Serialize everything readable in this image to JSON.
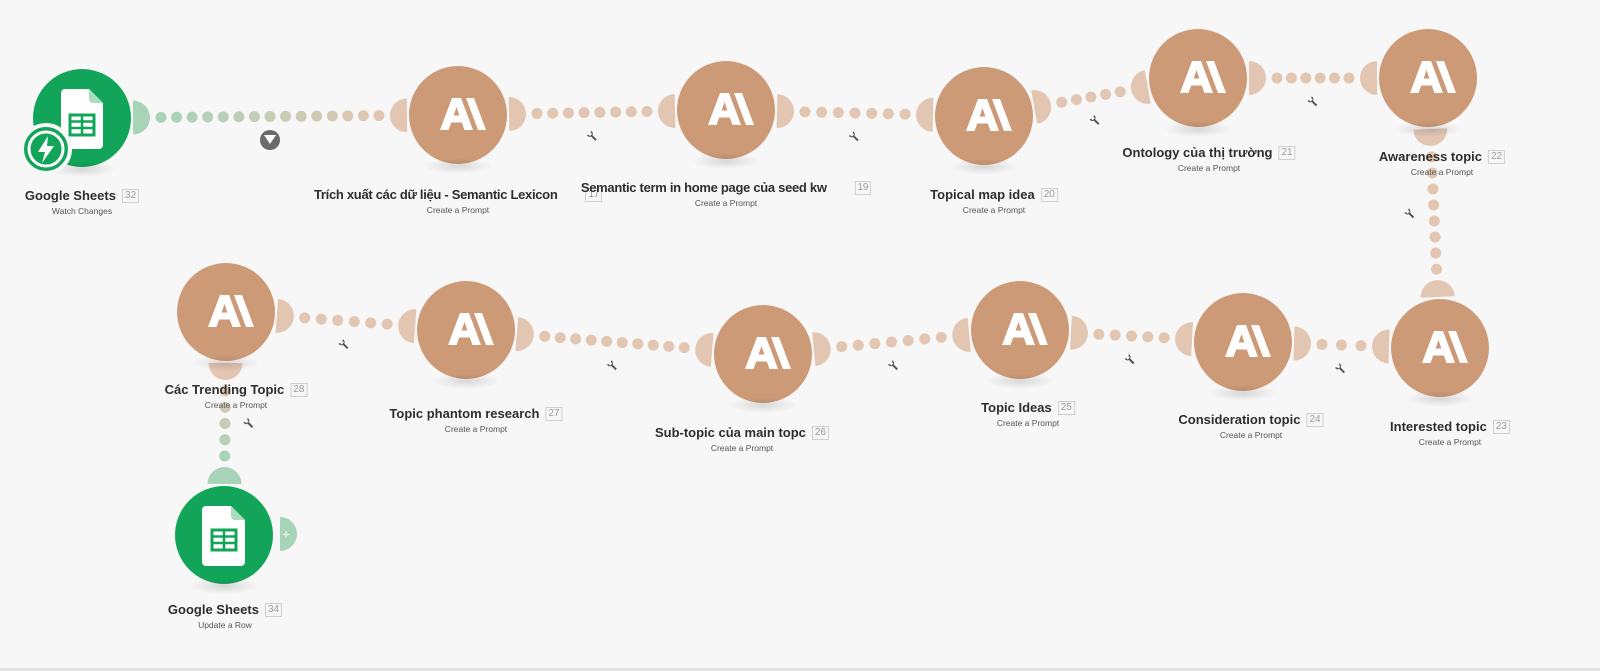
{
  "colors": {
    "ai_node": "#cd9a78",
    "sheets_node": "#12a559",
    "ai_connector": "#e2c6b2",
    "sheets_connector": "#a7d4b7",
    "background": "#f7f7f7"
  },
  "nodes": [
    {
      "id": "gs32",
      "app": "google-sheets",
      "title": "Google Sheets",
      "number": "32",
      "action": "Watch Changes",
      "trigger": true
    },
    {
      "id": "ai17",
      "app": "ai",
      "title": "Trích xuất các dữ liệu - Semantic Lexicon",
      "number": "17",
      "action": "Create a Prompt",
      "logo_text": "AI"
    },
    {
      "id": "ai19",
      "app": "ai",
      "title": "Semantic term in home page của seed kw",
      "number": "19",
      "action": "Create a Prompt",
      "logo_text": "AI"
    },
    {
      "id": "ai20",
      "app": "ai",
      "title": "Topical map idea",
      "number": "20",
      "action": "Create a Prompt",
      "logo_text": "AI"
    },
    {
      "id": "ai21",
      "app": "ai",
      "title": "Ontology của thị trường",
      "number": "21",
      "action": "Create a Prompt",
      "logo_text": "AI"
    },
    {
      "id": "ai22",
      "app": "ai",
      "title": "Awareness topic",
      "number": "22",
      "action": "Create a Prompt",
      "logo_text": "AI"
    },
    {
      "id": "ai23",
      "app": "ai",
      "title": "Interested topic",
      "number": "23",
      "action": "Create a Prompt",
      "logo_text": "AI"
    },
    {
      "id": "ai24",
      "app": "ai",
      "title": "Consideration topic",
      "number": "24",
      "action": "Create a Prompt",
      "logo_text": "AI"
    },
    {
      "id": "ai25",
      "app": "ai",
      "title": "Topic Ideas",
      "number": "25",
      "action": "Create a Prompt",
      "logo_text": "AI"
    },
    {
      "id": "ai26",
      "app": "ai",
      "title": "Sub-topic của main topc",
      "number": "26",
      "action": "Create a Prompt",
      "logo_text": "AI"
    },
    {
      "id": "ai27",
      "app": "ai",
      "title": "Topic phantom research",
      "number": "27",
      "action": "Create a Prompt",
      "logo_text": "AI"
    },
    {
      "id": "ai28",
      "app": "ai",
      "title": "Các Trending Topic",
      "number": "28",
      "action": "Create a Prompt",
      "logo_text": "AI"
    },
    {
      "id": "gs34",
      "app": "google-sheets",
      "title": "Google Sheets",
      "number": "34",
      "action": "Update a Row"
    }
  ],
  "connections": [
    {
      "from": "gs32",
      "to": "ai17",
      "marker": "filter-icon"
    },
    {
      "from": "ai17",
      "to": "ai19",
      "marker": "wrench-icon"
    },
    {
      "from": "ai19",
      "to": "ai20",
      "marker": "wrench-icon"
    },
    {
      "from": "ai20",
      "to": "ai21",
      "marker": "wrench-icon"
    },
    {
      "from": "ai21",
      "to": "ai22",
      "marker": "wrench-icon"
    },
    {
      "from": "ai22",
      "to": "ai23",
      "marker": "wrench-icon"
    },
    {
      "from": "ai23",
      "to": "ai24",
      "marker": "wrench-icon"
    },
    {
      "from": "ai24",
      "to": "ai25",
      "marker": "wrench-icon"
    },
    {
      "from": "ai25",
      "to": "ai26",
      "marker": "wrench-icon"
    },
    {
      "from": "ai26",
      "to": "ai27",
      "marker": "wrench-icon"
    },
    {
      "from": "ai27",
      "to": "ai28",
      "marker": "wrench-icon"
    },
    {
      "from": "ai28",
      "to": "gs34",
      "marker": "wrench-icon"
    }
  ],
  "add_module_symbol": "+"
}
